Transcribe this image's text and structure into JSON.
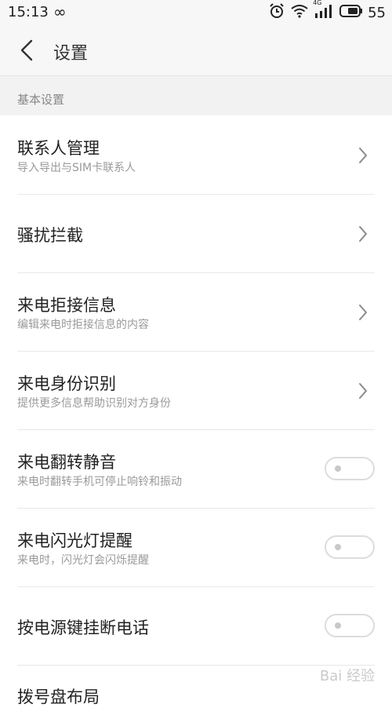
{
  "status_bar": {
    "time": "15:13",
    "loop_glyph": "∞",
    "network_label": "4G",
    "battery_percent": "55",
    "icons": [
      "alarm-icon",
      "wifi-icon",
      "signal-icon",
      "battery-icon"
    ]
  },
  "header": {
    "title": "设置",
    "back_icon": "chevron-left-icon"
  },
  "section": {
    "title": "基本设置"
  },
  "items": [
    {
      "title": "联系人管理",
      "subtitle": "导入导出与SIM卡联系人",
      "control": "chevron"
    },
    {
      "title": "骚扰拦截",
      "subtitle": "",
      "control": "chevron"
    },
    {
      "title": "来电拒接信息",
      "subtitle": "编辑来电时拒接信息的内容",
      "control": "chevron"
    },
    {
      "title": "来电身份识别",
      "subtitle": "提供更多信息帮助识别对方身份",
      "control": "chevron"
    },
    {
      "title": "来电翻转静音",
      "subtitle": "来电时翻转手机可停止响铃和振动",
      "control": "toggle",
      "state": "off"
    },
    {
      "title": "来电闪光灯提醒",
      "subtitle": "来电时，闪光灯会闪烁提醒",
      "control": "toggle",
      "state": "off"
    },
    {
      "title": "按电源键挂断电话",
      "subtitle": "",
      "control": "toggle",
      "state": "off"
    },
    {
      "title": "拨号盘布局",
      "subtitle": "",
      "control": "none"
    }
  ],
  "watermark": "Bai 经验",
  "colors": {
    "accent": "#222222",
    "subtitle": "#9a9a9a",
    "section_bg": "#f2f2f2",
    "toggle_border": "#dcdcdc"
  }
}
